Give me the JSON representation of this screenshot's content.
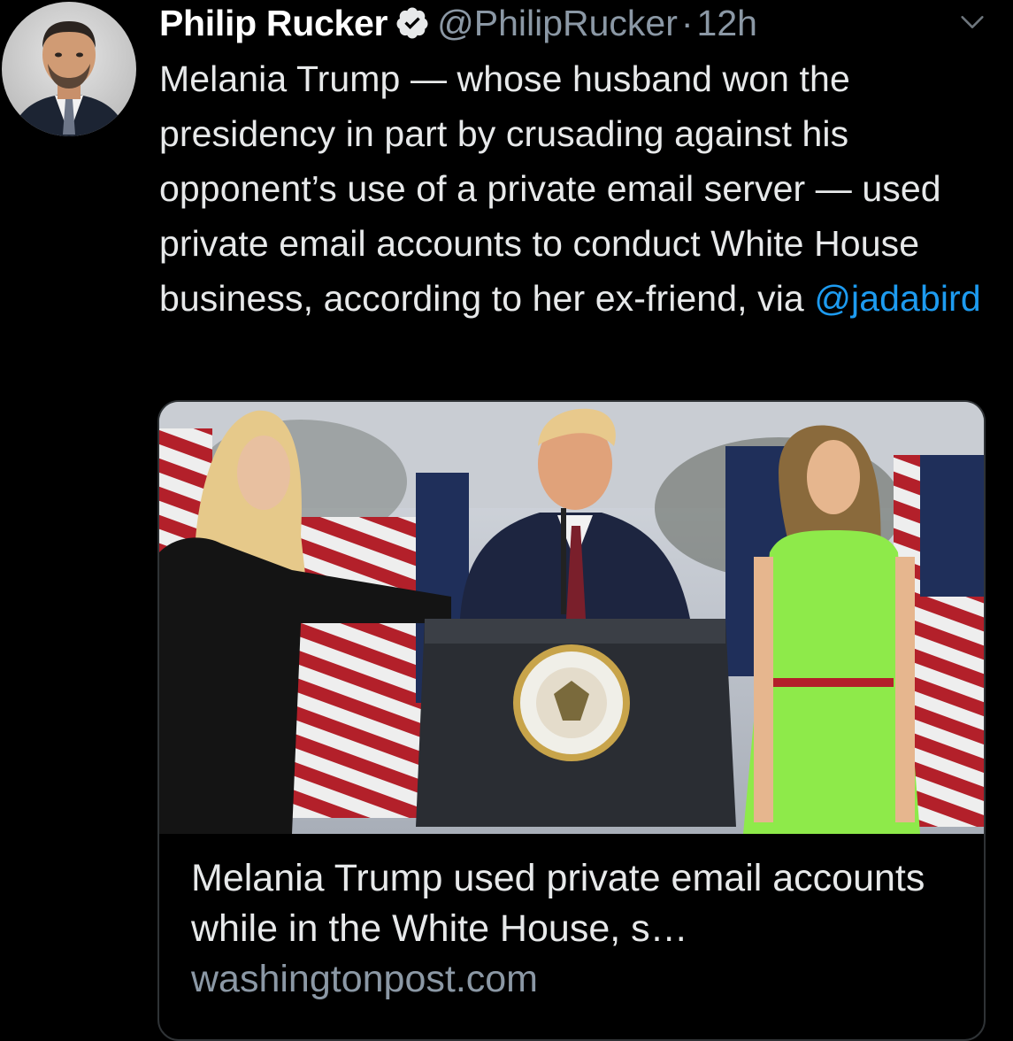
{
  "tweet": {
    "author": {
      "display_name": "Philip Rucker",
      "handle": "@PhilipRucker",
      "verified": true,
      "avatar_icon": "avatar-photo"
    },
    "separator": "·",
    "timestamp": "12h",
    "menu_icon": "chevron-down-icon",
    "text_before_mention": "Melania Trump — whose husband won the presidency in part by crusading against his opponent’s use of a private email server — used private email accounts to conduct White House business, according to her ex-friend, via ",
    "mention": "@jadabird",
    "colors": {
      "background": "#000000",
      "text": "#e7e9ea",
      "muted": "#8b98a5",
      "link": "#1d9bf0",
      "border": "#2f3336"
    }
  },
  "card": {
    "title": "Melania Trump used private email accounts while in the White House, s…",
    "domain": "washingtonpost.com"
  }
}
